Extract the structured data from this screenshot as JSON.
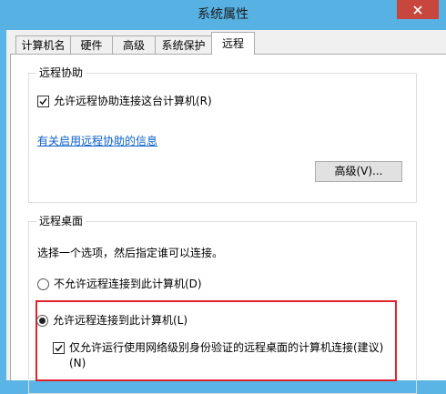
{
  "window": {
    "title": "系统属性"
  },
  "tabs": [
    {
      "label": "计算机名"
    },
    {
      "label": "硬件"
    },
    {
      "label": "高级"
    },
    {
      "label": "系统保护"
    },
    {
      "label": "远程"
    }
  ],
  "remote_assistance": {
    "legend": "远程协助",
    "allow_checkbox": {
      "label": "允许远程协助连接这台计算机(R)",
      "checked": true
    },
    "info_link": "有关启用远程协助的信息",
    "advanced_button": "高级(V)..."
  },
  "remote_desktop": {
    "legend": "远程桌面",
    "instruction": "选择一个选项，然后指定谁可以连接。",
    "option_disallow": {
      "label": "不允许远程连接到此计算机(D)",
      "selected": false
    },
    "option_allow": {
      "label": "允许远程连接到此计算机(L)",
      "selected": true
    },
    "nla_checkbox": {
      "label_line1": "仅允许运行使用网络级别身份验证的远程桌面的计算机连接(建议)",
      "label_line2": "(N)",
      "checked": true
    }
  },
  "colors": {
    "titlebar": "#57b1e3",
    "close_button": "#c7463d",
    "link": "#0b60c9",
    "highlight_border": "#e1232a"
  },
  "icons": {
    "close": "close-icon",
    "check": "checkmark-icon"
  }
}
